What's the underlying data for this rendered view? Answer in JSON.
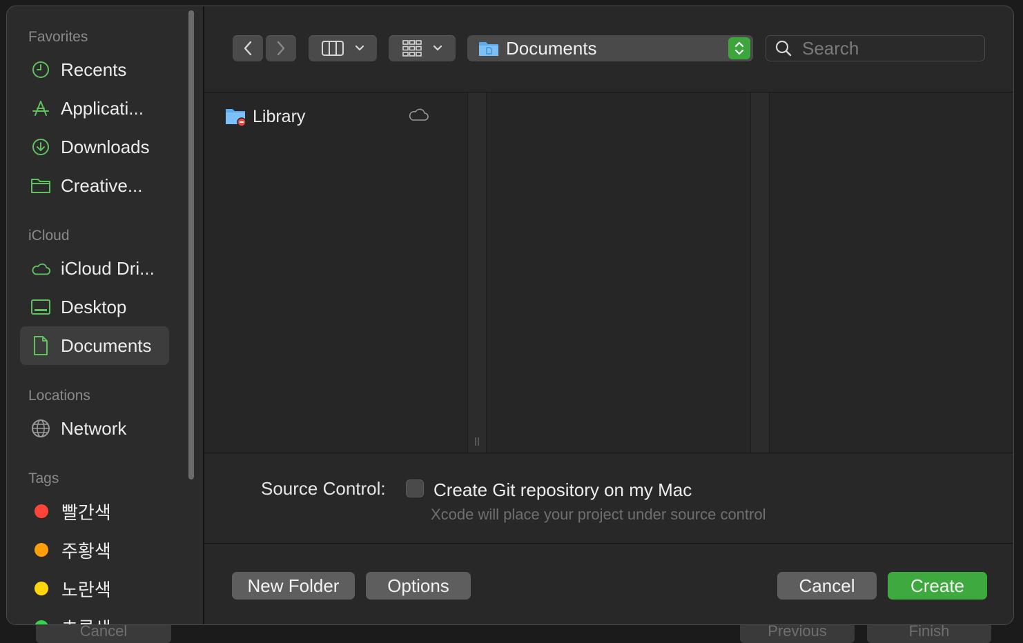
{
  "background_buttons": {
    "cancel_label": "Cancel",
    "previous_label": "Previous",
    "finish_label": "Finish"
  },
  "sidebar": {
    "sections": [
      {
        "title": "Favorites"
      },
      {
        "title": "iCloud"
      },
      {
        "title": "Locations"
      },
      {
        "title": "Tags"
      }
    ],
    "favorites": [
      {
        "label": "Recents",
        "icon": "clock-icon"
      },
      {
        "label": "Applicati...",
        "icon": "applications-icon"
      },
      {
        "label": "Downloads",
        "icon": "download-icon"
      },
      {
        "label": "Creative...",
        "icon": "folder-icon"
      }
    ],
    "icloud": [
      {
        "label": "iCloud Dri...",
        "icon": "cloud-icon"
      },
      {
        "label": "Desktop",
        "icon": "desktop-icon"
      },
      {
        "label": "Documents",
        "icon": "document-icon",
        "selected": true
      }
    ],
    "locations": [
      {
        "label": "Network",
        "icon": "globe-icon"
      }
    ],
    "tags": [
      {
        "label": "빨간색",
        "color": "#ff453a"
      },
      {
        "label": "주황색",
        "color": "#ff9f0a"
      },
      {
        "label": "노란색",
        "color": "#ffd60a"
      },
      {
        "label": "초록색",
        "color": "#32d74b"
      }
    ]
  },
  "toolbar": {
    "path_label": "Documents",
    "search_placeholder": "Search"
  },
  "browser": {
    "items": [
      {
        "label": "Library",
        "icon": "folder-restricted-icon",
        "status_icon": "cloud-icon"
      }
    ]
  },
  "options": {
    "source_control_label": "Source Control:",
    "checkbox_label": "Create Git repository on my Mac",
    "checkbox_checked": false,
    "hint": "Xcode will place your project under source control"
  },
  "buttons": {
    "new_folder": "New Folder",
    "options": "Options",
    "cancel": "Cancel",
    "create": "Create"
  },
  "colors": {
    "accent": "#3ea93e",
    "sidebar_icon": "#5fc25f",
    "folder_blue": "#5aaaf0"
  }
}
